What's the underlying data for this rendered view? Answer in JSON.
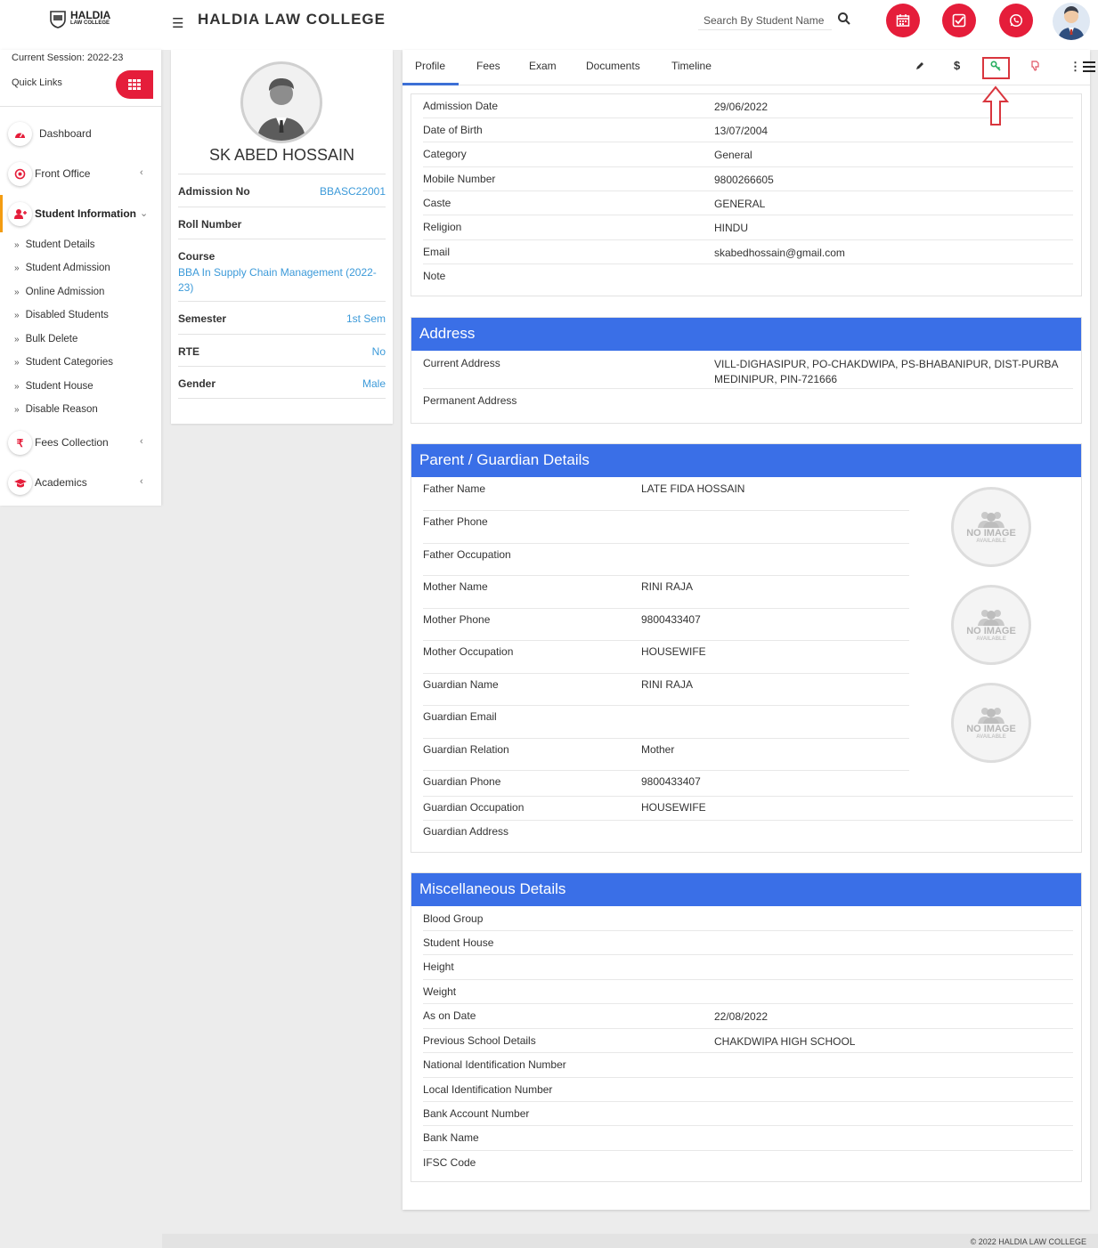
{
  "header": {
    "logo_line1": "HALDIA",
    "logo_line2": "LAW COLLEGE",
    "title": "HALDIA LAW COLLEGE",
    "search_placeholder": "Search By Student Name",
    "action_icons": [
      "calendar-icon",
      "checkbox-icon",
      "whatsapp-icon"
    ],
    "accent_color": "#e51d3a"
  },
  "sidebar": {
    "session": "Current Session: 2022-23",
    "quick_links": "Quick Links",
    "items": [
      {
        "label": "Dashboard",
        "icon": "dashboard-icon"
      },
      {
        "label": "Front Office",
        "icon": "front-office-icon"
      },
      {
        "label": "Student Information",
        "icon": "student-icon"
      },
      {
        "label": "Fees Collection",
        "icon": "rupee-icon"
      },
      {
        "label": "Academics",
        "icon": "graduation-cap-icon"
      }
    ],
    "sub_items": [
      "Student Details",
      "Student Admission",
      "Online Admission",
      "Disabled Students",
      "Bulk Delete",
      "Student Categories",
      "Student House",
      "Disable Reason"
    ]
  },
  "profile": {
    "name": "SK ABED HOSSAIN",
    "rows": [
      {
        "label": "Admission No",
        "value": "BBASC22001"
      },
      {
        "label": "Roll Number",
        "value": ""
      },
      {
        "label": "Course",
        "value": "BBA In Supply Chain Management (2022-23)"
      },
      {
        "label": "Semester",
        "value": "1st Sem"
      },
      {
        "label": "RTE",
        "value": "No"
      },
      {
        "label": "Gender",
        "value": "Male"
      }
    ]
  },
  "tabs": [
    "Profile",
    "Fees",
    "Exam",
    "Documents",
    "Timeline"
  ],
  "tab_icons": [
    "pencil-icon",
    "dollar-icon",
    "key-icon",
    "thumbs-down-icon"
  ],
  "basic": [
    {
      "label": "Admission Date",
      "value": "29/06/2022"
    },
    {
      "label": "Date of Birth",
      "value": "13/07/2004"
    },
    {
      "label": "Category",
      "value": "General"
    },
    {
      "label": "Mobile Number",
      "value": "9800266605"
    },
    {
      "label": "Caste",
      "value": "GENERAL"
    },
    {
      "label": "Religion",
      "value": "HINDU"
    },
    {
      "label": "Email",
      "value": "skabedhossain@gmail.com"
    },
    {
      "label": "Note",
      "value": ""
    }
  ],
  "address": {
    "title": "Address",
    "rows": [
      {
        "label": "Current Address",
        "value": "VILL-DIGHASIPUR, PO-CHAKDWIPA, PS-BHABANIPUR, DIST-PURBA MEDINIPUR, PIN-721666"
      },
      {
        "label": "Permanent Address",
        "value": ""
      }
    ]
  },
  "guardian": {
    "title": "Parent / Guardian Details",
    "no_image_1": "NO IMAGE",
    "no_image_2": "AVAILABLE",
    "rows": [
      {
        "label": "Father Name",
        "value": "LATE FIDA HOSSAIN"
      },
      {
        "label": "Father Phone",
        "value": ""
      },
      {
        "label": "Father Occupation",
        "value": ""
      },
      {
        "label": "Mother Name",
        "value": "RINI RAJA"
      },
      {
        "label": "Mother Phone",
        "value": "9800433407"
      },
      {
        "label": "Mother Occupation",
        "value": "HOUSEWIFE"
      },
      {
        "label": "Guardian Name",
        "value": "RINI RAJA"
      },
      {
        "label": "Guardian Email",
        "value": ""
      },
      {
        "label": "Guardian Relation",
        "value": "Mother"
      },
      {
        "label": "Guardian Phone",
        "value": "9800433407"
      },
      {
        "label": "Guardian Occupation",
        "value": "HOUSEWIFE"
      },
      {
        "label": "Guardian Address",
        "value": ""
      }
    ]
  },
  "misc": {
    "title": "Miscellaneous Details",
    "rows": [
      {
        "label": "Blood Group",
        "value": ""
      },
      {
        "label": "Student House",
        "value": ""
      },
      {
        "label": "Height",
        "value": ""
      },
      {
        "label": "Weight",
        "value": ""
      },
      {
        "label": "As on Date",
        "value": "22/08/2022"
      },
      {
        "label": "Previous School Details",
        "value": "CHAKDWIPA HIGH SCHOOL"
      },
      {
        "label": "National Identification Number",
        "value": ""
      },
      {
        "label": "Local Identification Number",
        "value": ""
      },
      {
        "label": "Bank Account Number",
        "value": ""
      },
      {
        "label": "Bank Name",
        "value": ""
      },
      {
        "label": "IFSC Code",
        "value": ""
      }
    ]
  },
  "footer": "© 2022 HALDIA LAW COLLEGE"
}
